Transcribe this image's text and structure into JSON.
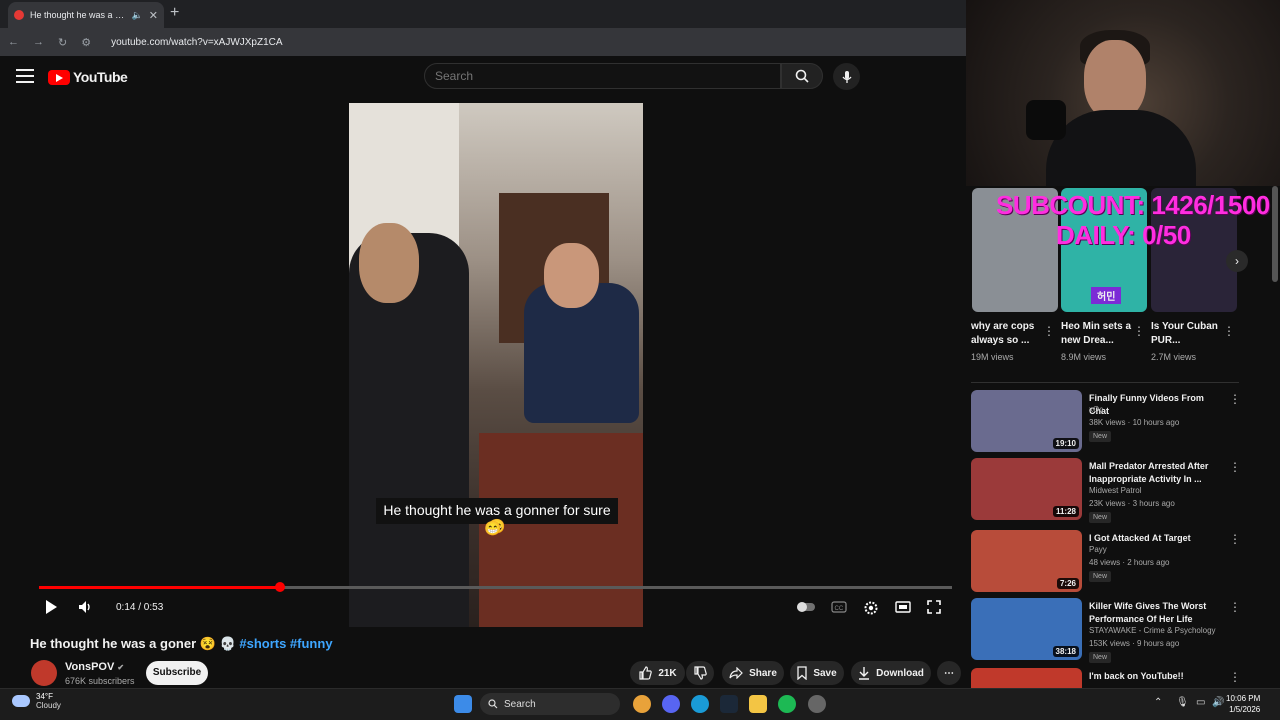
{
  "browser": {
    "tab_title": "He thought he was a goner",
    "tab_close": "✕",
    "new_tab": "+",
    "url": "youtube.com/watch?v=xAJWJXpZ1CA"
  },
  "header": {
    "logo_text": "YouTube",
    "search_placeholder": "Search"
  },
  "player": {
    "caption_line1": "He thought he was a gonner for sure 😄",
    "caption_line2": "😁",
    "time": "0:14 / 0:53",
    "progress": 0.264
  },
  "video": {
    "title": "He thought he was a goner 😵 💀",
    "hashtags": "#shorts #funny",
    "channel": "VonsPOV",
    "verified": "✔",
    "subscribers": "676K subscribers",
    "subscribe_label": "Subscribe",
    "likes": "21K",
    "share_label": "Share",
    "save_label": "Save",
    "download_label": "Download"
  },
  "overlay": {
    "subcount": "SUBCOUNT: 1426/1500",
    "daily": "DAILY: 0/50"
  },
  "shorts": [
    {
      "title": "why are cops always so ...",
      "views": "19M views",
      "color": "#8a8f95"
    },
    {
      "title": "Heo Min sets a new Drea...",
      "views": "8.9M views",
      "color": "#2fb3a6",
      "badge": "허민"
    },
    {
      "title": "Is Your Cuban PUR...",
      "views": "2.7M views",
      "color": "#2a2438"
    }
  ],
  "recommendations": [
    {
      "title": "Finally Funny Videos From Chat",
      "channel": "xQc",
      "meta": "38K views · 10 hours ago",
      "badge": "New",
      "duration": "19:10",
      "color": "#6a6b8f"
    },
    {
      "title": "Mall Predator Arrested After Inappropriate Activity In ...",
      "channel": "Midwest Patrol",
      "meta": "23K views · 3 hours ago",
      "badge": "New",
      "duration": "11:28",
      "color": "#9b3a3a"
    },
    {
      "title": "I Got Attacked At Target",
      "channel": "Payy",
      "meta": "48 views · 2 hours ago",
      "badge": "New",
      "duration": "7:26",
      "color": "#b84c3a"
    },
    {
      "title": "Killer Wife Gives The Worst Performance Of Her Life",
      "channel": "STAYAWAKE - Crime & Psychology",
      "meta": "153K views · 9 hours ago",
      "badge": "New",
      "duration": "38:18",
      "color": "#3a6fb8"
    },
    {
      "title": "I'm back on YouTube!!",
      "channel": "",
      "meta": "",
      "badge": "",
      "duration": "",
      "color": "#c0392b"
    }
  ],
  "taskbar": {
    "temp": "34°F",
    "condition": "Cloudy",
    "search_label": "Search",
    "time": "10:06 PM",
    "date": "1/5/2026"
  },
  "colors": {
    "youtube_red": "#ff0000",
    "link_blue": "#3ea6ff",
    "overlay_magenta": "#ff2de0"
  }
}
